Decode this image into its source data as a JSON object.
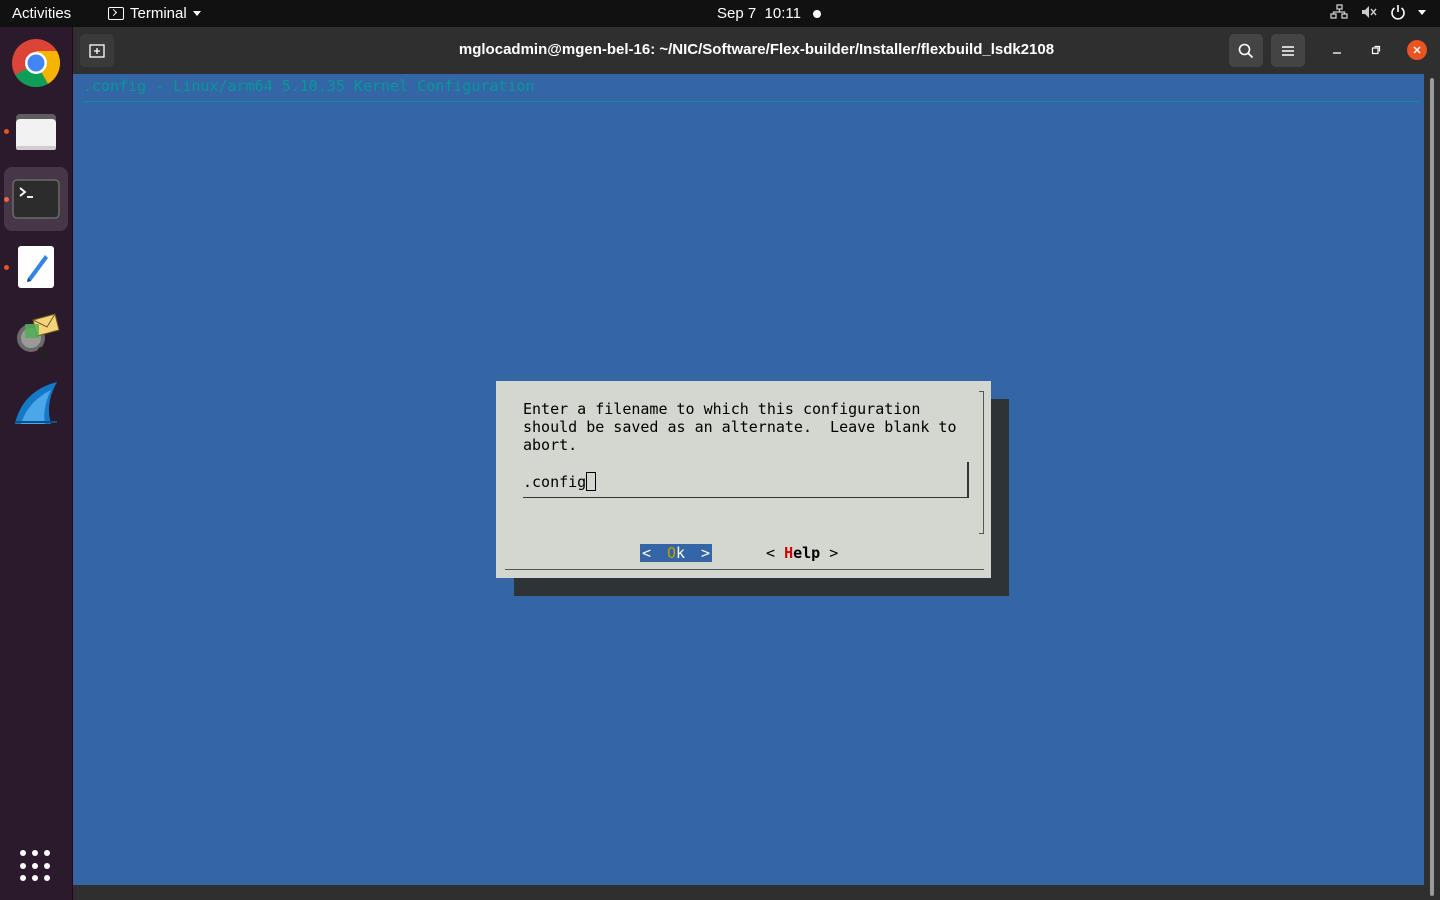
{
  "topbar": {
    "activities": "Activities",
    "app_name": "Terminal",
    "date": "Sep 7",
    "time": "10:11"
  },
  "dock": {
    "items": [
      {
        "name": "chrome-icon",
        "running": false,
        "active": false
      },
      {
        "name": "files-icon",
        "running": true,
        "active": false
      },
      {
        "name": "terminal-icon",
        "running": true,
        "active": true
      },
      {
        "name": "text-editor-icon",
        "running": true,
        "active": false
      },
      {
        "name": "mail-app-icon",
        "running": false,
        "active": false
      },
      {
        "name": "wireshark-icon",
        "running": false,
        "active": false
      }
    ],
    "show_apps": "show-applications-icon"
  },
  "window": {
    "title": "mglocadmin@mgen-bel-16: ~/NIC/Software/Flex-builder/Installer/flexbuild_lsdk2108"
  },
  "terminal": {
    "header": ".config - Linux/arm64 5.10.35 Kernel Configuration",
    "dialog": {
      "message": "Enter a filename to which this configuration\nshould be saved as an alternate.  Leave blank to\nabort.",
      "input_value": ".config",
      "ok": {
        "left": "<",
        "hot": "O",
        "rest": "k",
        "right": ">"
      },
      "help": {
        "left": "< ",
        "hot": "H",
        "rest": "elp",
        "right": " >"
      }
    }
  },
  "colors": {
    "terminal_bg": "#3465a4",
    "dialog_bg": "#d3d7cf",
    "header_text": "#06989a",
    "accent": "#e95420"
  }
}
